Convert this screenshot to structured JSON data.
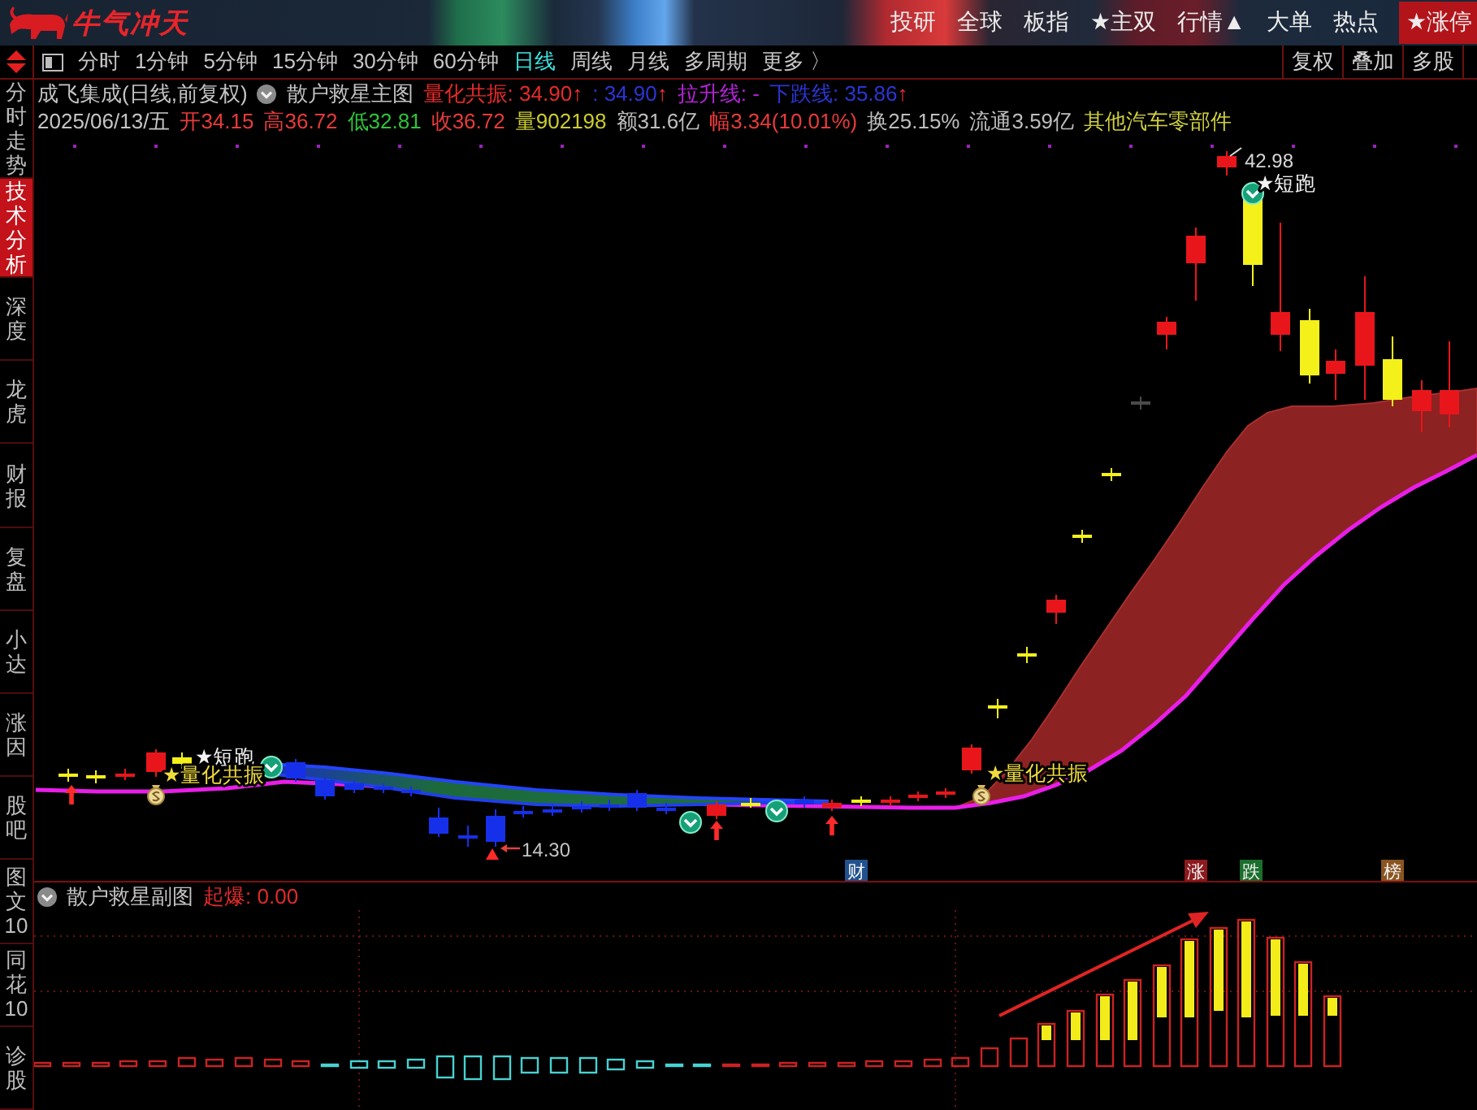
{
  "title_bar": {
    "logo": "牛气冲天",
    "menu": [
      {
        "label": "投研",
        "selected": false
      },
      {
        "label": "全球",
        "selected": false
      },
      {
        "label": "板指",
        "selected": false
      },
      {
        "label": "★主双",
        "selected": false
      },
      {
        "label": "行情▲",
        "selected": false
      },
      {
        "label": "大单",
        "selected": false
      },
      {
        "label": "热点",
        "selected": false
      },
      {
        "label": "★涨停",
        "selected": true
      }
    ]
  },
  "toolbar": {
    "periods": [
      {
        "label": "分时",
        "selected": false
      },
      {
        "label": "1分钟",
        "selected": false
      },
      {
        "label": "5分钟",
        "selected": false
      },
      {
        "label": "15分钟",
        "selected": false
      },
      {
        "label": "30分钟",
        "selected": false
      },
      {
        "label": "60分钟",
        "selected": false
      },
      {
        "label": "日线",
        "selected": true
      },
      {
        "label": "周线",
        "selected": false
      },
      {
        "label": "月线",
        "selected": false
      },
      {
        "label": "多周期",
        "selected": false
      },
      {
        "label": "更多 〉",
        "selected": false
      }
    ],
    "buttons": [
      "复权",
      "叠加",
      "多股"
    ]
  },
  "sidebar": {
    "items": [
      {
        "label": "分时走势",
        "selected": false
      },
      {
        "label": "技术分析",
        "selected": true
      },
      {
        "label": "深度",
        "selected": false
      },
      {
        "label": "龙虎",
        "selected": false
      },
      {
        "label": "财报",
        "selected": false
      },
      {
        "label": "复盘",
        "selected": false
      },
      {
        "label": "小达",
        "selected": false
      },
      {
        "label": "涨因",
        "selected": false
      },
      {
        "label": "股吧",
        "selected": false
      },
      {
        "label": "图文10",
        "selected": false
      },
      {
        "label": "同花10",
        "selected": false
      },
      {
        "label": "诊股",
        "selected": false
      }
    ]
  },
  "main_chart": {
    "security": "成飞集成(日线,前复权)",
    "indicator": "散户救星主图",
    "readings": [
      {
        "label": "量化共振:",
        "value": "34.90",
        "arrow": "↑",
        "color": "#e62a2a"
      },
      {
        "label": ":",
        "value": "34.90",
        "arrow": "↑",
        "color": "#2a36d4"
      },
      {
        "label": "拉升线:",
        "value": "-",
        "color": "#b424d8"
      },
      {
        "label": "下跌线:",
        "value": "35.86",
        "arrow": "↑",
        "color": "#2a36d4"
      }
    ],
    "date": "2025/06/13/五",
    "quote": [
      {
        "label": "开",
        "value": "34.15",
        "color": "#e83a3a"
      },
      {
        "label": "高",
        "value": "36.72",
        "color": "#e83a3a"
      },
      {
        "label": "低",
        "value": "32.81",
        "color": "#2ec43a"
      },
      {
        "label": "收",
        "value": "36.72",
        "color": "#e83a3a"
      },
      {
        "label": "量",
        "value": "902198",
        "color": "#cccc2e"
      },
      {
        "label": "额",
        "value": "31.6亿",
        "color": "#bdbdbd"
      },
      {
        "label": "幅",
        "value": "3.34(10.01%)",
        "color": "#e83a3a"
      },
      {
        "label": "换",
        "value": "25.15%",
        "color": "#bdbdbd"
      },
      {
        "label": "流通",
        "value": "3.59亿",
        "color": "#bdbdbd"
      }
    ],
    "industry": "其他汽车零部件",
    "high_label": "42.98",
    "low_label": "14.30",
    "signals": [
      {
        "text": "★短跑",
        "color": "#f2f2f2"
      },
      {
        "text": "★量化共振",
        "color": "#f0dc3c"
      },
      {
        "text": "★量化共振",
        "color": "#f0dc3c"
      },
      {
        "text": "★短跑",
        "color": "#f2f2f2"
      }
    ],
    "tags": [
      {
        "text": "财",
        "color": "#21528f"
      },
      {
        "text": "涨",
        "color": "#8c1a1e"
      },
      {
        "text": "跌",
        "color": "#1b6e2c"
      },
      {
        "text": "榜",
        "color": "#8a5420"
      }
    ]
  },
  "sub_chart": {
    "indicator": "散户救星副图",
    "reading": {
      "label": "起爆:",
      "value": "0.00"
    }
  }
}
